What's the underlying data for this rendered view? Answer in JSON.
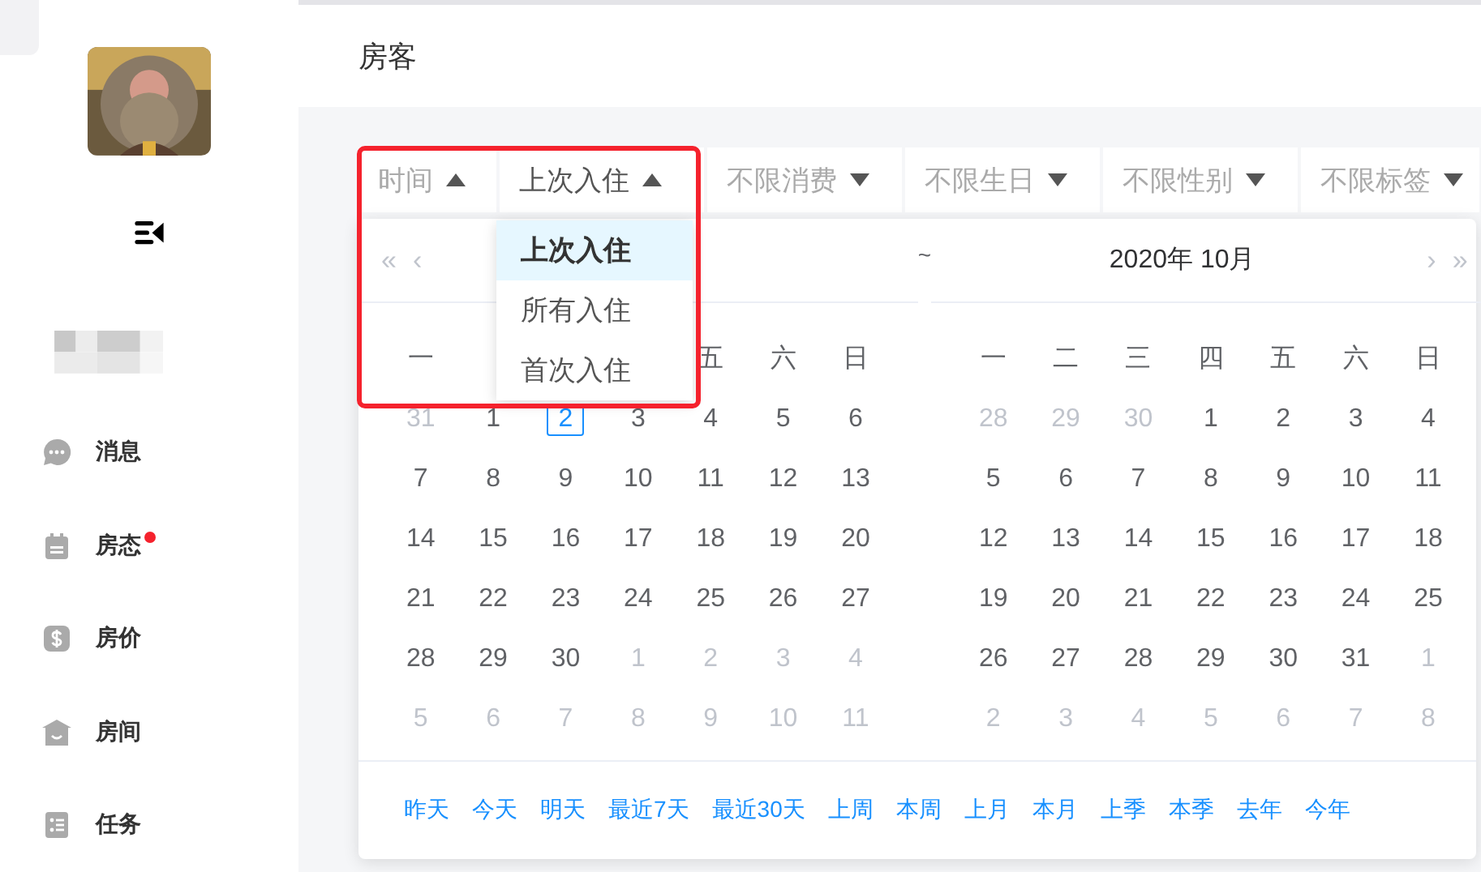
{
  "sidebar": {
    "nav": [
      {
        "label": "消息",
        "badge": false
      },
      {
        "label": "房态",
        "badge": true
      },
      {
        "label": "房价",
        "badge": false
      },
      {
        "label": "房间",
        "badge": false
      },
      {
        "label": "任务",
        "badge": false
      }
    ]
  },
  "header": {
    "title": "房客"
  },
  "filters": [
    {
      "label": "时间",
      "open": true,
      "selected": false
    },
    {
      "label": "上次入住",
      "open": true,
      "selected": true
    },
    {
      "label": "不限消费",
      "open": false,
      "selected": false
    },
    {
      "label": "不限生日",
      "open": false,
      "selected": false
    },
    {
      "label": "不限性别",
      "open": false,
      "selected": false
    },
    {
      "label": "不限标签",
      "open": false,
      "selected": false
    }
  ],
  "dropdown": [
    {
      "label": "上次入住",
      "selected": true
    },
    {
      "label": "所有入住",
      "selected": false
    },
    {
      "label": "首次入住",
      "selected": false
    }
  ],
  "range_separator": "~",
  "calendars": [
    {
      "nav_prev": [
        "«",
        "‹"
      ],
      "weekdays": [
        "一",
        "五",
        "六",
        "日"
      ],
      "weeks": [
        [
          {
            "d": "31",
            "muted": true,
            "today": false
          },
          {
            "d": "1",
            "muted": false,
            "today": false
          },
          {
            "d": "2",
            "muted": false,
            "today": true
          },
          {
            "d": "3",
            "muted": false,
            "today": false
          },
          {
            "d": "4",
            "muted": false,
            "today": false
          },
          {
            "d": "5",
            "muted": false,
            "today": false
          },
          {
            "d": "6",
            "muted": false,
            "today": false
          }
        ],
        [
          {
            "d": "7",
            "muted": false,
            "today": false
          },
          {
            "d": "8",
            "muted": false,
            "today": false
          },
          {
            "d": "9",
            "muted": false,
            "today": false
          },
          {
            "d": "10",
            "muted": false,
            "today": false
          },
          {
            "d": "11",
            "muted": false,
            "today": false
          },
          {
            "d": "12",
            "muted": false,
            "today": false
          },
          {
            "d": "13",
            "muted": false,
            "today": false
          }
        ],
        [
          {
            "d": "14",
            "muted": false,
            "today": false
          },
          {
            "d": "15",
            "muted": false,
            "today": false
          },
          {
            "d": "16",
            "muted": false,
            "today": false
          },
          {
            "d": "17",
            "muted": false,
            "today": false
          },
          {
            "d": "18",
            "muted": false,
            "today": false
          },
          {
            "d": "19",
            "muted": false,
            "today": false
          },
          {
            "d": "20",
            "muted": false,
            "today": false
          }
        ],
        [
          {
            "d": "21",
            "muted": false,
            "today": false
          },
          {
            "d": "22",
            "muted": false,
            "today": false
          },
          {
            "d": "23",
            "muted": false,
            "today": false
          },
          {
            "d": "24",
            "muted": false,
            "today": false
          },
          {
            "d": "25",
            "muted": false,
            "today": false
          },
          {
            "d": "26",
            "muted": false,
            "today": false
          },
          {
            "d": "27",
            "muted": false,
            "today": false
          }
        ],
        [
          {
            "d": "28",
            "muted": false,
            "today": false
          },
          {
            "d": "29",
            "muted": false,
            "today": false
          },
          {
            "d": "30",
            "muted": false,
            "today": false
          },
          {
            "d": "1",
            "muted": true,
            "today": false
          },
          {
            "d": "2",
            "muted": true,
            "today": false
          },
          {
            "d": "3",
            "muted": true,
            "today": false
          },
          {
            "d": "4",
            "muted": true,
            "today": false
          }
        ],
        [
          {
            "d": "5",
            "muted": true,
            "today": false
          },
          {
            "d": "6",
            "muted": true,
            "today": false
          },
          {
            "d": "7",
            "muted": true,
            "today": false
          },
          {
            "d": "8",
            "muted": true,
            "today": false
          },
          {
            "d": "9",
            "muted": true,
            "today": false
          },
          {
            "d": "10",
            "muted": true,
            "today": false
          },
          {
            "d": "11",
            "muted": true,
            "today": false
          }
        ]
      ]
    },
    {
      "title": "2020年 10月",
      "nav_next": [
        "›",
        "»"
      ],
      "weekdays": [
        "一",
        "二",
        "三",
        "四",
        "五",
        "六",
        "日"
      ],
      "weeks": [
        [
          {
            "d": "28",
            "muted": true,
            "today": false
          },
          {
            "d": "29",
            "muted": true,
            "today": false
          },
          {
            "d": "30",
            "muted": true,
            "today": false
          },
          {
            "d": "1",
            "muted": false,
            "today": false
          },
          {
            "d": "2",
            "muted": false,
            "today": false
          },
          {
            "d": "3",
            "muted": false,
            "today": false
          },
          {
            "d": "4",
            "muted": false,
            "today": false
          }
        ],
        [
          {
            "d": "5",
            "muted": false,
            "today": false
          },
          {
            "d": "6",
            "muted": false,
            "today": false
          },
          {
            "d": "7",
            "muted": false,
            "today": false
          },
          {
            "d": "8",
            "muted": false,
            "today": false
          },
          {
            "d": "9",
            "muted": false,
            "today": false
          },
          {
            "d": "10",
            "muted": false,
            "today": false
          },
          {
            "d": "11",
            "muted": false,
            "today": false
          }
        ],
        [
          {
            "d": "12",
            "muted": false,
            "today": false
          },
          {
            "d": "13",
            "muted": false,
            "today": false
          },
          {
            "d": "14",
            "muted": false,
            "today": false
          },
          {
            "d": "15",
            "muted": false,
            "today": false
          },
          {
            "d": "16",
            "muted": false,
            "today": false
          },
          {
            "d": "17",
            "muted": false,
            "today": false
          },
          {
            "d": "18",
            "muted": false,
            "today": false
          }
        ],
        [
          {
            "d": "19",
            "muted": false,
            "today": false
          },
          {
            "d": "20",
            "muted": false,
            "today": false
          },
          {
            "d": "21",
            "muted": false,
            "today": false
          },
          {
            "d": "22",
            "muted": false,
            "today": false
          },
          {
            "d": "23",
            "muted": false,
            "today": false
          },
          {
            "d": "24",
            "muted": false,
            "today": false
          },
          {
            "d": "25",
            "muted": false,
            "today": false
          }
        ],
        [
          {
            "d": "26",
            "muted": false,
            "today": false
          },
          {
            "d": "27",
            "muted": false,
            "today": false
          },
          {
            "d": "28",
            "muted": false,
            "today": false
          },
          {
            "d": "29",
            "muted": false,
            "today": false
          },
          {
            "d": "30",
            "muted": false,
            "today": false
          },
          {
            "d": "31",
            "muted": false,
            "today": false
          },
          {
            "d": "1",
            "muted": true,
            "today": false
          }
        ],
        [
          {
            "d": "2",
            "muted": true,
            "today": false
          },
          {
            "d": "3",
            "muted": true,
            "today": false
          },
          {
            "d": "4",
            "muted": true,
            "today": false
          },
          {
            "d": "5",
            "muted": true,
            "today": false
          },
          {
            "d": "6",
            "muted": true,
            "today": false
          },
          {
            "d": "7",
            "muted": true,
            "today": false
          },
          {
            "d": "8",
            "muted": true,
            "today": false
          }
        ]
      ]
    }
  ],
  "shortcuts": [
    "昨天",
    "今天",
    "明天",
    "最近7天",
    "最近30天",
    "上周",
    "本周",
    "上月",
    "本月",
    "上季",
    "本季",
    "去年",
    "今年"
  ]
}
